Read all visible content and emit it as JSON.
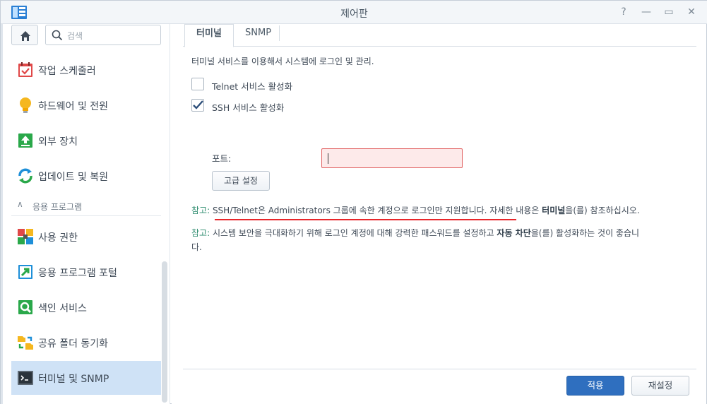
{
  "window": {
    "title": "제어판",
    "icon": "control-panel-icon",
    "buttons": [
      "help-icon",
      "minimize-icon",
      "maximize-icon",
      "close-icon"
    ]
  },
  "sidebar": {
    "search_placeholder": "검색",
    "items": [
      {
        "label": "작업 스케줄러",
        "icon": "task-scheduler-icon"
      },
      {
        "label": "하드웨어 및 전원",
        "icon": "lightbulb-icon"
      },
      {
        "label": "외부 장치",
        "icon": "external-device-icon"
      },
      {
        "label": "업데이트 및 복원",
        "icon": "update-restore-icon"
      }
    ],
    "section_header": "응용 프로그램",
    "app_items": [
      {
        "label": "사용 권한",
        "icon": "privileges-icon"
      },
      {
        "label": "응용 프로그램 포털",
        "icon": "app-portal-icon"
      },
      {
        "label": "색인 서비스",
        "icon": "indexing-service-icon"
      },
      {
        "label": "공유 폴더 동기화",
        "icon": "shared-folder-sync-icon"
      },
      {
        "label": "터미널 및 SNMP",
        "icon": "terminal-icon"
      }
    ]
  },
  "tabs": [
    {
      "label": "터미널",
      "active": true
    },
    {
      "label": "SNMP",
      "active": false
    }
  ],
  "content": {
    "description": "터미널 서비스를 이용해서 시스템에 로그인 및 관리.",
    "telnet_label": "Telnet 서비스 활성화",
    "telnet_checked": false,
    "ssh_label": "SSH 서비스 활성화",
    "ssh_checked": true,
    "port_label": "포트:",
    "port_value": "",
    "advanced_button": "고급 설정",
    "note1_prefix": "참고:",
    "note1_text_a": " SSH/Telnet은 Administrators 그룹에 속한 계정으로 로그인만 지원합니다. 자세한 내용은 ",
    "note1_bold": "터미널",
    "note1_text_b": "을(를) 참조하십시오.",
    "note2_prefix": "참고:",
    "note2_text_a": " 시스템 보안을 극대화하기 위해 로그인 계정에 대해 강력한 패스워드를 설정하고 ",
    "note2_bold": "자동 차단",
    "note2_text_b": "을(를) 활성화하는 것이 좋습니",
    "note2_text_c": "다."
  },
  "footer": {
    "apply_label": "적용",
    "reset_label": "재설정"
  },
  "colors": {
    "accent": "#2f6fbf",
    "active_nav": "#cfe2f6",
    "error_border": "#e26565",
    "note_prefix": "#2a8a6c",
    "annotation_line": "#e8262a"
  }
}
